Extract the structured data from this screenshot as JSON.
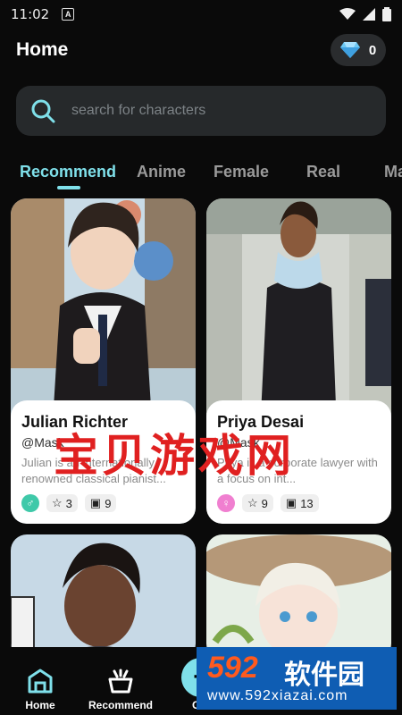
{
  "status": {
    "time": "11:02",
    "a_icon": "A"
  },
  "header": {
    "title": "Home",
    "gems_count": "0"
  },
  "search": {
    "placeholder": "search for characters"
  },
  "tabs": [
    {
      "label": "Recommend",
      "active": true
    },
    {
      "label": "Anime"
    },
    {
      "label": "Female"
    },
    {
      "label": "Real"
    },
    {
      "label": "Ma"
    }
  ],
  "cards": [
    {
      "name": "Julian Richter",
      "handle": "@Mask",
      "desc": "Julian is an internationally renowned classical pianist...",
      "gender": "male",
      "stars": "3",
      "images": "9"
    },
    {
      "name": "Priya Desai",
      "handle": "@Mask",
      "desc": "Priya is a corporate lawyer with a focus on int...",
      "gender": "female",
      "stars": "9",
      "images": "13"
    },
    {
      "name": "",
      "handle": "",
      "desc": "",
      "gender": "",
      "stars": "",
      "images": ""
    },
    {
      "name": "",
      "handle": "",
      "desc": "",
      "gender": "",
      "stars": "",
      "images": ""
    }
  ],
  "watermark": "宝贝游戏网",
  "nav": {
    "home": "Home",
    "recommend": "Recommend",
    "create": "Cre"
  },
  "brand": {
    "number": "592",
    "name": "软件园",
    "url": "www.592xiazai.com"
  },
  "colors": {
    "accent": "#7fe0ea",
    "background": "#0a0a0a",
    "male": "#3fc9a9",
    "female": "#f07fd0"
  }
}
